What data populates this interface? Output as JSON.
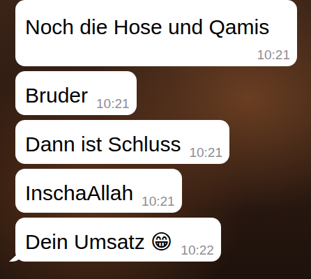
{
  "chat": {
    "messages": [
      {
        "text": "Noch die Hose und Qamis",
        "time": "10:21"
      },
      {
        "text": "Bruder",
        "time": "10:21"
      },
      {
        "text": "Dann ist Schluss",
        "time": "10:21"
      },
      {
        "text": "InschaAllah",
        "time": "10:21"
      },
      {
        "text": "Dein Umsatz 😁",
        "time": "10:22"
      }
    ]
  }
}
